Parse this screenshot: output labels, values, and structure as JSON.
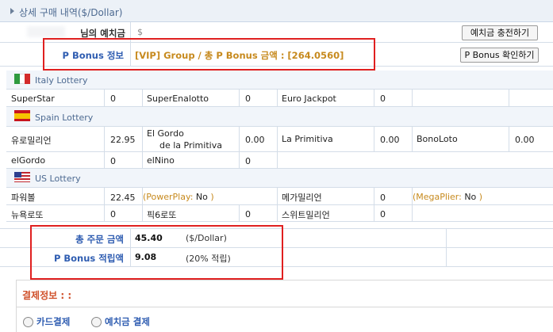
{
  "header": {
    "title": "상세 구매 내역($/Dollar)"
  },
  "deposit": {
    "label": "님의 예치금",
    "value": "$",
    "charge_button": "예치금 충전하기"
  },
  "bonus": {
    "label": "P Bonus 정보",
    "text": "[VIP] Group / 총 P Bonus 금액 : [264.0560]",
    "check_button": "P Bonus 확인하기"
  },
  "italy": {
    "title": "Italy Lottery",
    "games": [
      {
        "name": "SuperStar",
        "qty": "0"
      },
      {
        "name": "SuperEnalotto",
        "qty": "0"
      },
      {
        "name": "Euro Jackpot",
        "qty": "0"
      }
    ]
  },
  "spain": {
    "title": "Spain Lottery",
    "games": [
      {
        "name": "유로밀리언",
        "qty": "22.95"
      },
      {
        "name": "El Gordo",
        "name2": "de la Primitiva",
        "qty": "0.00"
      },
      {
        "name": "La Primitiva",
        "qty": "0.00"
      },
      {
        "name": "BonoLoto",
        "qty": "0.00"
      },
      {
        "name": "elGordo",
        "qty": "0"
      },
      {
        "name": "elNino",
        "qty": "0"
      }
    ]
  },
  "us": {
    "title": "US Lottery",
    "games": [
      {
        "name": "파워볼",
        "qty": "22.45"
      },
      {
        "name": "메가밀리언",
        "qty": "0"
      },
      {
        "name": "뉴욕로또",
        "qty": "0"
      },
      {
        "name": "픽6로또",
        "qty": "0"
      },
      {
        "name": "스위트밀리언",
        "qty": "0"
      }
    ],
    "powerplay": {
      "open": "(PowerPlay:",
      "value": "No",
      "close": ")"
    },
    "megaplier": {
      "open": "(MegaPlier:",
      "value": "No",
      "close": ")"
    }
  },
  "summary": {
    "total_label": "총 주문 금액",
    "total_value": "45.40",
    "total_unit": "($/Dollar)",
    "bonus_label": "P Bonus 적립액",
    "bonus_value": "9.08",
    "bonus_note": "(20% 적립)"
  },
  "payment": {
    "title": "결제정보 : :",
    "card": "카드결제",
    "deposit": "예치금 결제"
  },
  "colors": {
    "accent": "#2f5db1",
    "highlight_box": "#e02020",
    "payment_title": "#d0502a"
  }
}
